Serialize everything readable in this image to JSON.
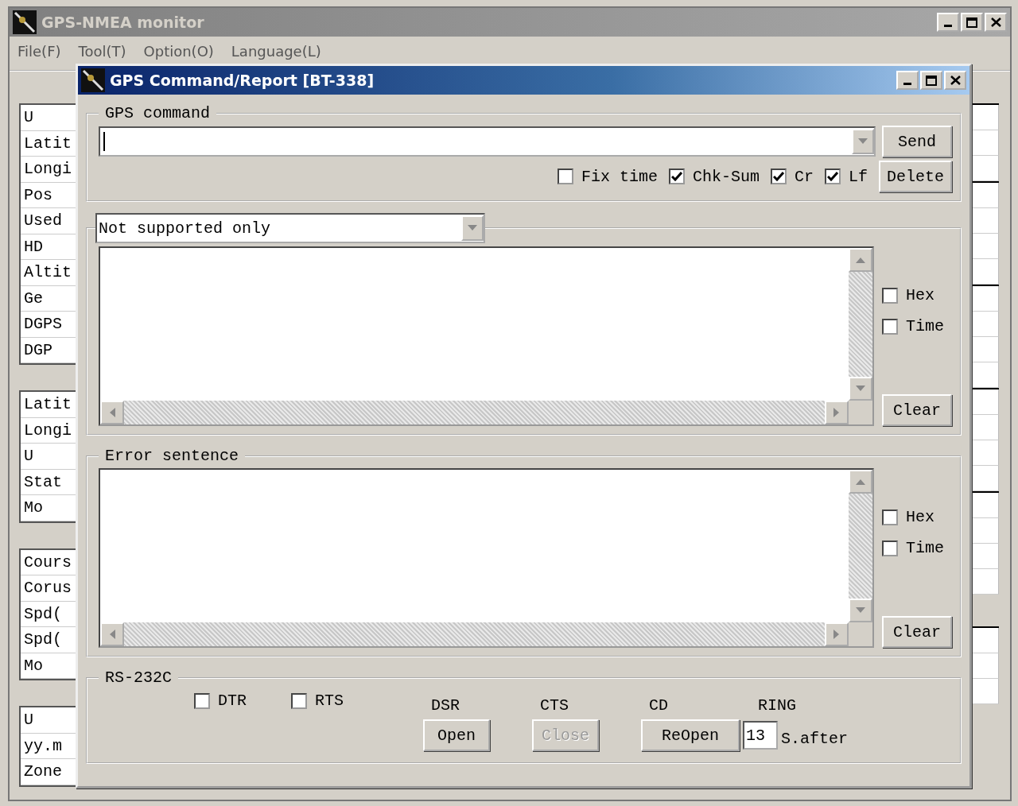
{
  "main_window": {
    "title": "GPS-NMEA monitor",
    "active": false,
    "menu": [
      "File(F)",
      "Tool(T)",
      "Option(O)",
      "Language(L)"
    ],
    "label_groups": [
      [
        "U",
        "Latit",
        "Longi",
        "Pos",
        "Used",
        "HD",
        "Altit",
        "Ge",
        "DGPS",
        "DGP"
      ],
      [
        "Latit",
        "Longi",
        "U",
        "Stat",
        "Mo"
      ],
      [
        "Cours",
        "Corus",
        "Spd(",
        "Spd(",
        "Mo"
      ],
      [
        "U",
        "yy.m",
        "Zone"
      ]
    ]
  },
  "dialog": {
    "title": "GPS Command/Report [BT-338]",
    "active": true,
    "command_group": {
      "legend": "GPS command",
      "send_button": "Send",
      "delete_button": "Delete",
      "options": [
        {
          "label": "Fix time",
          "checked": false
        },
        {
          "label": "Chk-Sum",
          "checked": true
        },
        {
          "label": "Cr",
          "checked": true
        },
        {
          "label": "Lf",
          "checked": true
        }
      ]
    },
    "log_panes": [
      {
        "kind": "filter",
        "filter": "Not supported only",
        "clear_button": "Clear",
        "options": [
          {
            "label": "Hex",
            "checked": false
          },
          {
            "label": "Time",
            "checked": false
          }
        ]
      },
      {
        "kind": "titled",
        "legend": "Error sentence",
        "clear_button": "Clear",
        "options": [
          {
            "label": "Hex",
            "checked": false
          },
          {
            "label": "Time",
            "checked": false
          }
        ]
      }
    ],
    "rs232c": {
      "legend": "RS-232C",
      "lines": [
        {
          "label": "DTR",
          "checked": false
        },
        {
          "label": "RTS",
          "checked": false
        }
      ],
      "signals": [
        "DSR",
        "CTS",
        "CD",
        "RING"
      ],
      "buttons": [
        {
          "label": "Open",
          "disabled": false
        },
        {
          "label": "Close",
          "disabled": true
        },
        {
          "label": "ReOpen",
          "disabled": false
        }
      ],
      "reopen_delay": "13",
      "reopen_unit": "S.after"
    }
  }
}
